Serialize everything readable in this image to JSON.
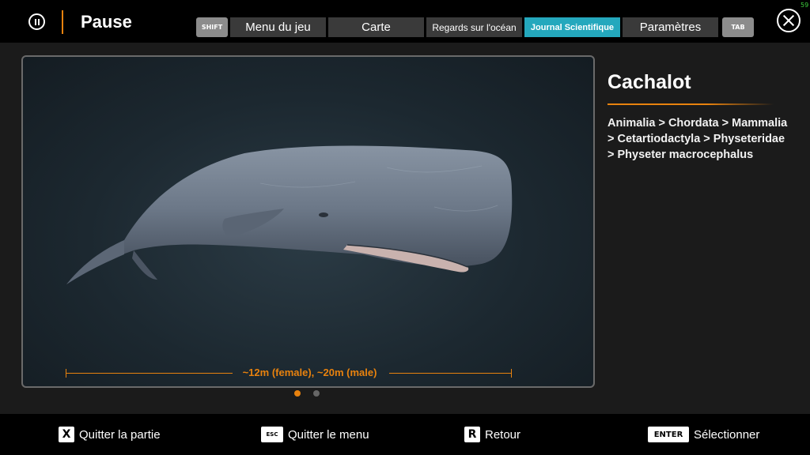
{
  "header": {
    "title": "Pause",
    "shift_key": "SHIFT",
    "tab_key": "TAB",
    "fps": "59",
    "tabs": [
      {
        "label": "Menu du jeu",
        "active": false
      },
      {
        "label": "Carte",
        "active": false
      },
      {
        "label": "Regards sur l'océan",
        "active": false
      },
      {
        "label": "Journal Scientifique",
        "active": true
      },
      {
        "label": "Paramètres",
        "active": false
      }
    ]
  },
  "entry": {
    "name": "Cachalot",
    "taxonomy": "Animalia > Chordata > Mammalia > Cetartiodactyla > Physeteridae > Physeter macrocephalus",
    "size_label": "~12m (female), ~20m (male)",
    "image_count": 2,
    "image_index": 1
  },
  "footer": {
    "actions": [
      {
        "key": "X",
        "label": "Quitter la partie"
      },
      {
        "key": "ESC",
        "label": "Quitter le menu"
      },
      {
        "key": "R",
        "label": "Retour"
      },
      {
        "key": "ENTER",
        "label": "Sélectionner"
      }
    ]
  },
  "colors": {
    "accent": "#e8820e",
    "active_tab": "#24a8bd"
  }
}
